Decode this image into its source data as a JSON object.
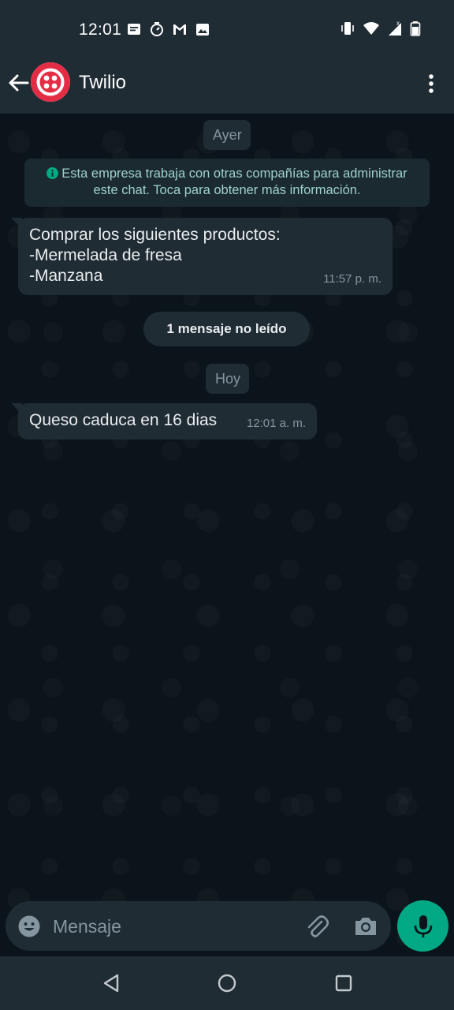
{
  "status_bar": {
    "time": "12:01",
    "left_icons": [
      "message-notification-icon",
      "timer-icon",
      "gmail-icon",
      "gallery-icon"
    ],
    "right_icons": [
      "vibrate-icon",
      "wifi-icon",
      "signal-icon",
      "battery-icon"
    ]
  },
  "header": {
    "title": "Twilio",
    "avatar_brand_color": "#e22d45"
  },
  "chat": {
    "date_yesterday": "Ayer",
    "info_banner_line1": "Esta empresa trabaja con otras compañías para administrar",
    "info_banner_line2": "este chat. Toca para obtener más información.",
    "messages": [
      {
        "lines": [
          "Comprar los siguientes productos:",
          "-Mermelada de fresa",
          "-Manzana"
        ],
        "time": "11:57 p. m."
      },
      {
        "lines": [
          "Queso caduca en 16 dias"
        ],
        "time": "12:01 a. m."
      }
    ],
    "unread_label": "1 mensaje no leído",
    "date_today": "Hoy"
  },
  "composer": {
    "placeholder": "Mensaje"
  },
  "colors": {
    "background": "#0b141a",
    "bar": "#1f2c34",
    "bubble": "#202c33",
    "accent": "#00a884",
    "info_text": "#9ed2c9"
  }
}
